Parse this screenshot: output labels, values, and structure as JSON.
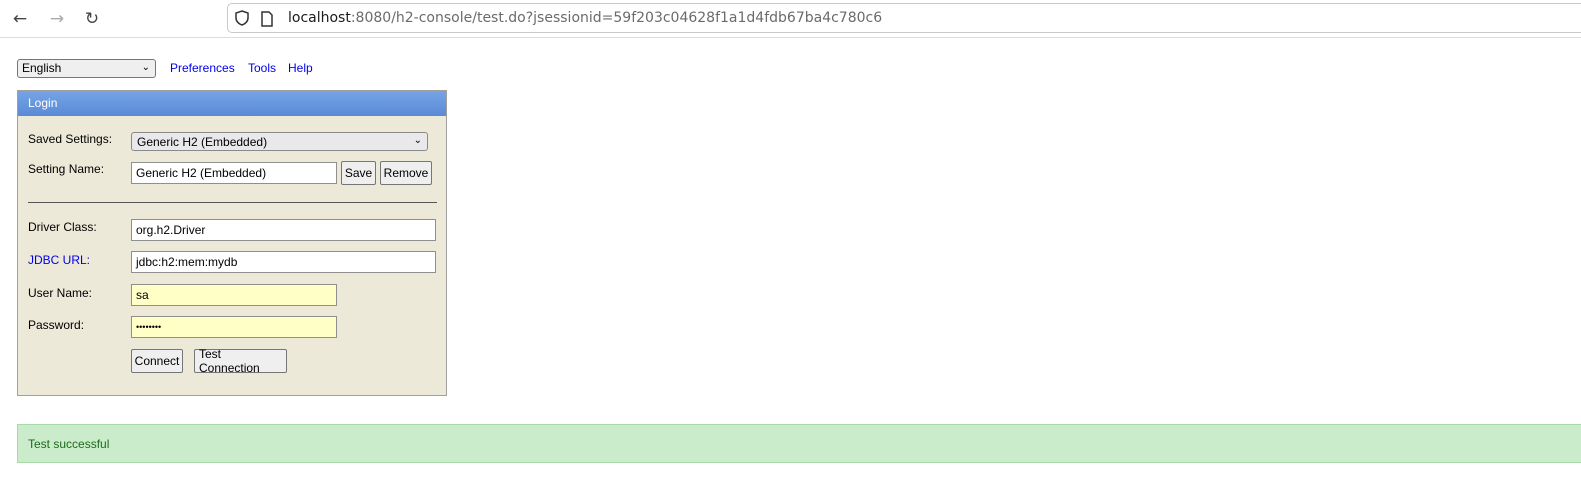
{
  "browser": {
    "url_host": "localhost",
    "url_rest": ":8080/h2-console/test.do?jsessionid=59f203c04628f1a1d4fdb67ba4c780c6"
  },
  "top": {
    "language": "English",
    "links": [
      "Preferences",
      "Tools",
      "Help"
    ]
  },
  "login": {
    "title": "Login",
    "saved_settings_label": "Saved Settings:",
    "saved_settings_value": "Generic H2 (Embedded)",
    "setting_name_label": "Setting Name:",
    "setting_name_value": "Generic H2 (Embedded)",
    "save_button": "Save",
    "remove_button": "Remove",
    "driver_class_label": "Driver Class:",
    "driver_class_value": "org.h2.Driver",
    "jdbc_url_label": "JDBC URL:",
    "jdbc_url_value": "jdbc:h2:mem:mydb",
    "user_name_label": "User Name:",
    "user_name_value": "sa",
    "password_label": "Password:",
    "password_value": "••••••••",
    "connect_button": "Connect",
    "test_connection_button": "Test Connection"
  },
  "status": {
    "message": "Test successful"
  }
}
